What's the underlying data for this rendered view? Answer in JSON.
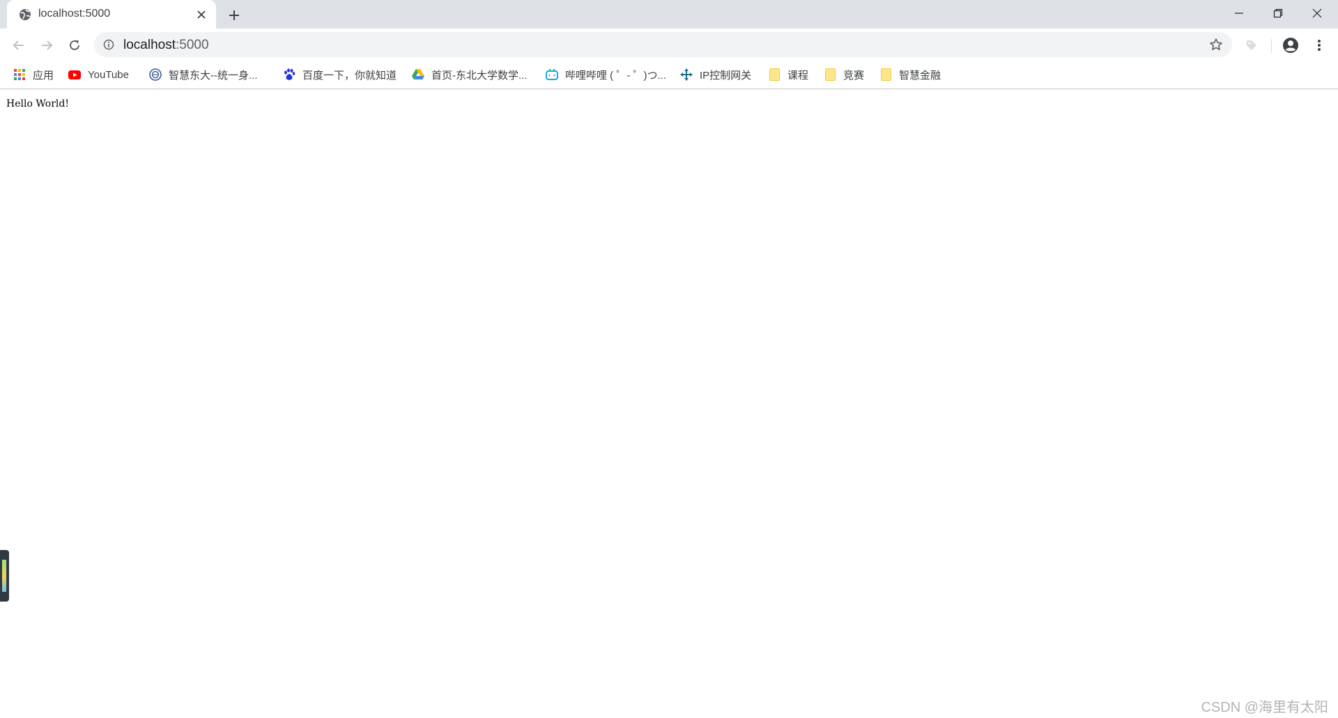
{
  "tab": {
    "title": "localhost:5000"
  },
  "omnibox": {
    "host": "localhost",
    "port": ":5000"
  },
  "bookmarks": [
    {
      "label": "应用",
      "icon": "apps-grid-icon"
    },
    {
      "label": "YouTube",
      "icon": "youtube-icon"
    },
    {
      "label": "智慧东大--统一身...",
      "icon": "university-seal-icon"
    },
    {
      "label": "百度一下，你就知道",
      "icon": "baidu-paw-icon"
    },
    {
      "label": "首页-东北大学数学...",
      "icon": "google-drive-icon"
    },
    {
      "label": "哔哩哔哩 ( ゜- ゜)つ...",
      "icon": "bilibili-tv-icon"
    },
    {
      "label": "IP控制网关",
      "icon": "gateway-icon"
    },
    {
      "label": "课程",
      "icon": "folder-icon"
    },
    {
      "label": "竞赛",
      "icon": "folder-icon"
    },
    {
      "label": "智慧金融",
      "icon": "folder-icon"
    }
  ],
  "page": {
    "text": "Hello World!"
  },
  "watermark": {
    "text": "CSDN @海里有太阳"
  },
  "colors": {
    "tab_strip": "#dee1e6",
    "omnibox": "#f1f3f4",
    "youtube_red": "#ff0000",
    "folder_yellow": "#fde68a"
  }
}
